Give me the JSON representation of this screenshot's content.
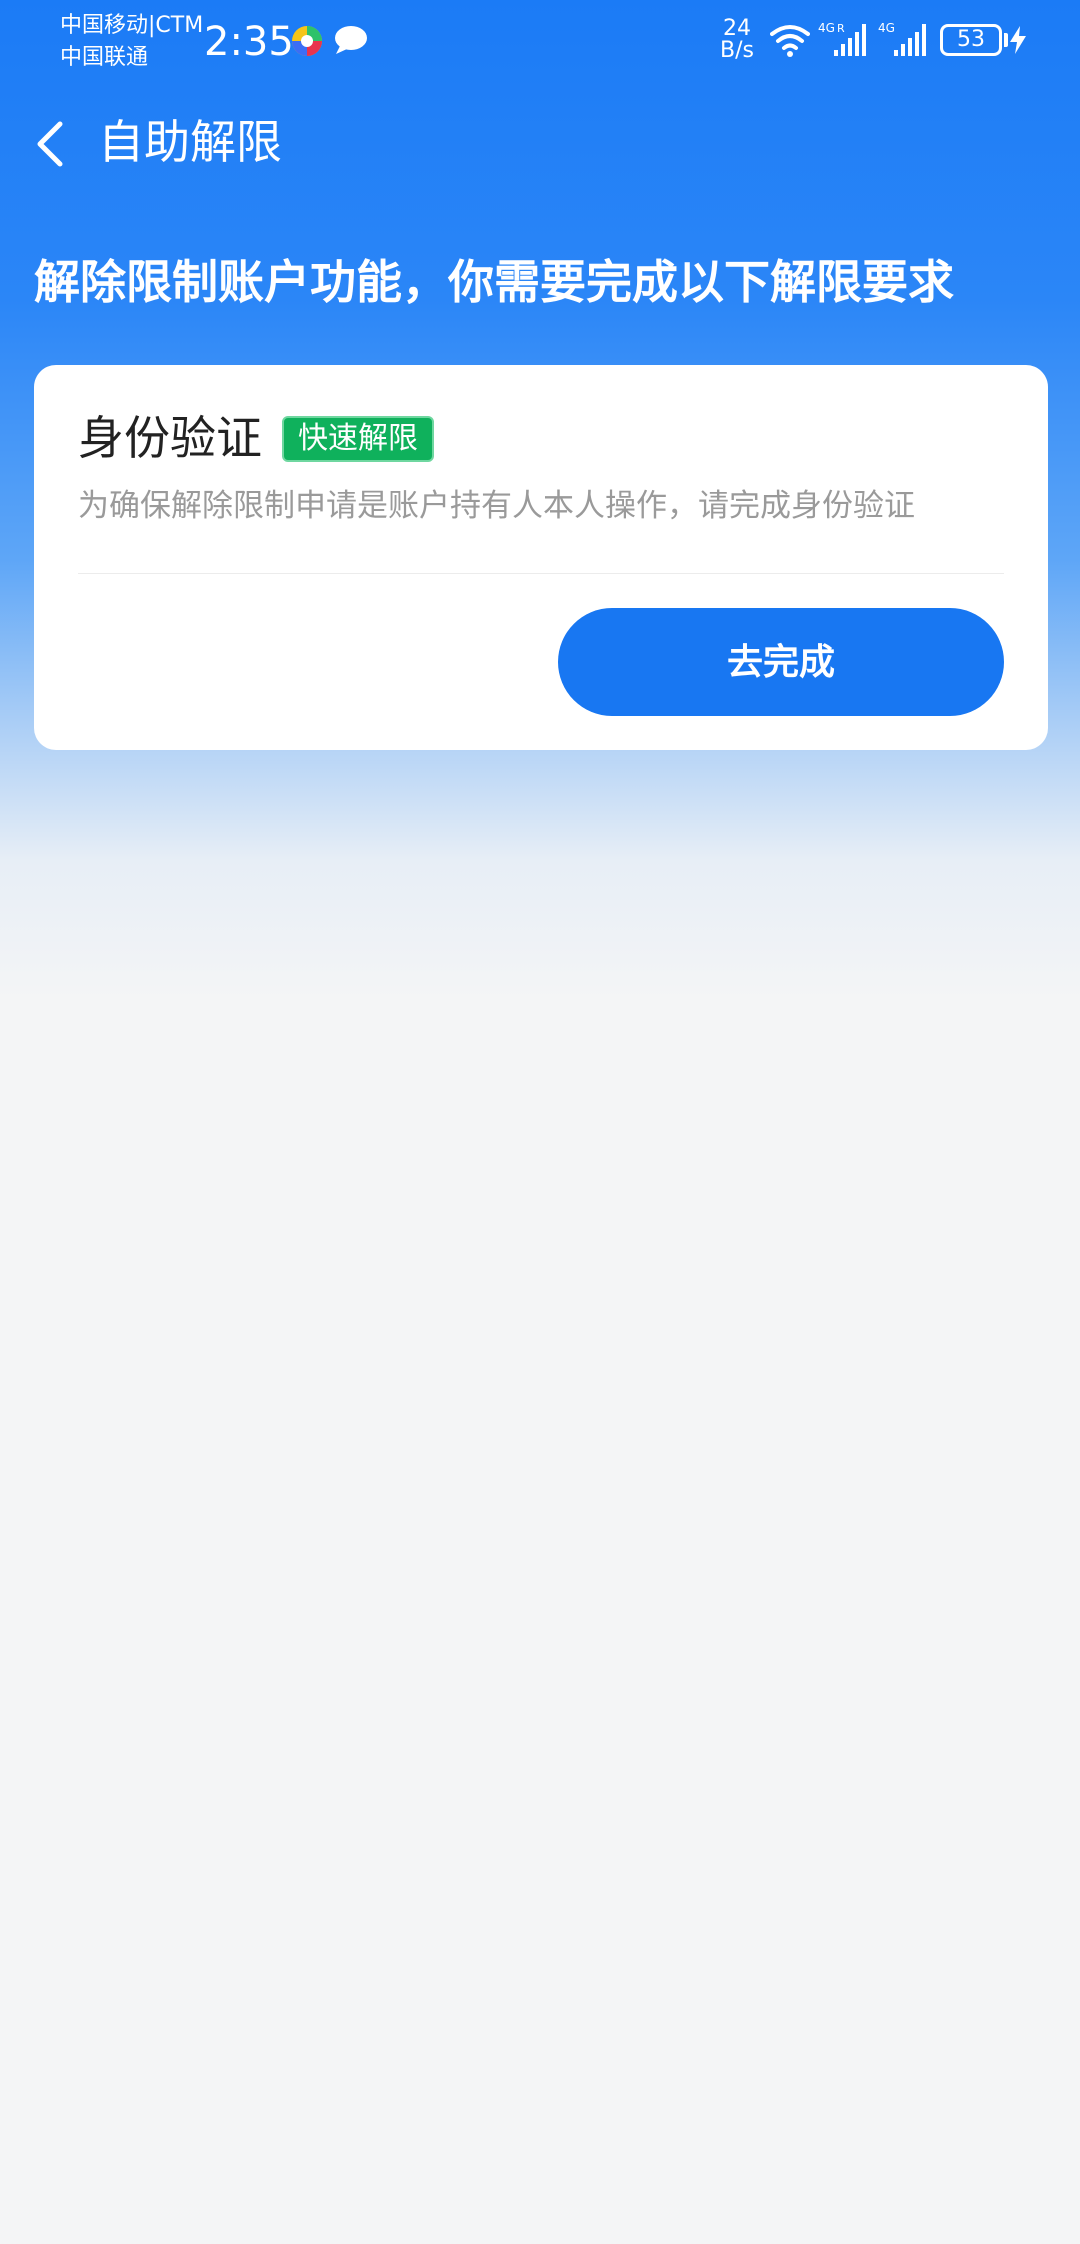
{
  "status_bar": {
    "carrier_1": "中国移动|CTM",
    "carrier_2": "中国联通",
    "time": "2:35",
    "net_speed_value": "24",
    "net_speed_unit": "B/s",
    "signal_1_label": "4G",
    "signal_1_roaming": "R",
    "signal_2_label": "4G",
    "battery": "53",
    "icons": [
      "app-notification-icon",
      "message-bubble-icon",
      "wifi-icon",
      "signal-strength-icon",
      "signal-strength-icon",
      "battery-icon",
      "charging-bolt-icon"
    ]
  },
  "nav": {
    "back_icon": "chevron-left-icon",
    "title": "自助解限"
  },
  "headline": "解除限制账户功能，你需要完成以下解限要求",
  "card": {
    "title": "身份验证",
    "badge": "快速解限",
    "description": "为确保解除限制申请是账户持有人本人操作，请完成身份验证",
    "button_label": "去完成"
  },
  "colors": {
    "header_blue": "#1b7bf6",
    "button_blue": "#1877f2",
    "badge_green": "#0fb15c",
    "background": "#f4f5f6"
  }
}
